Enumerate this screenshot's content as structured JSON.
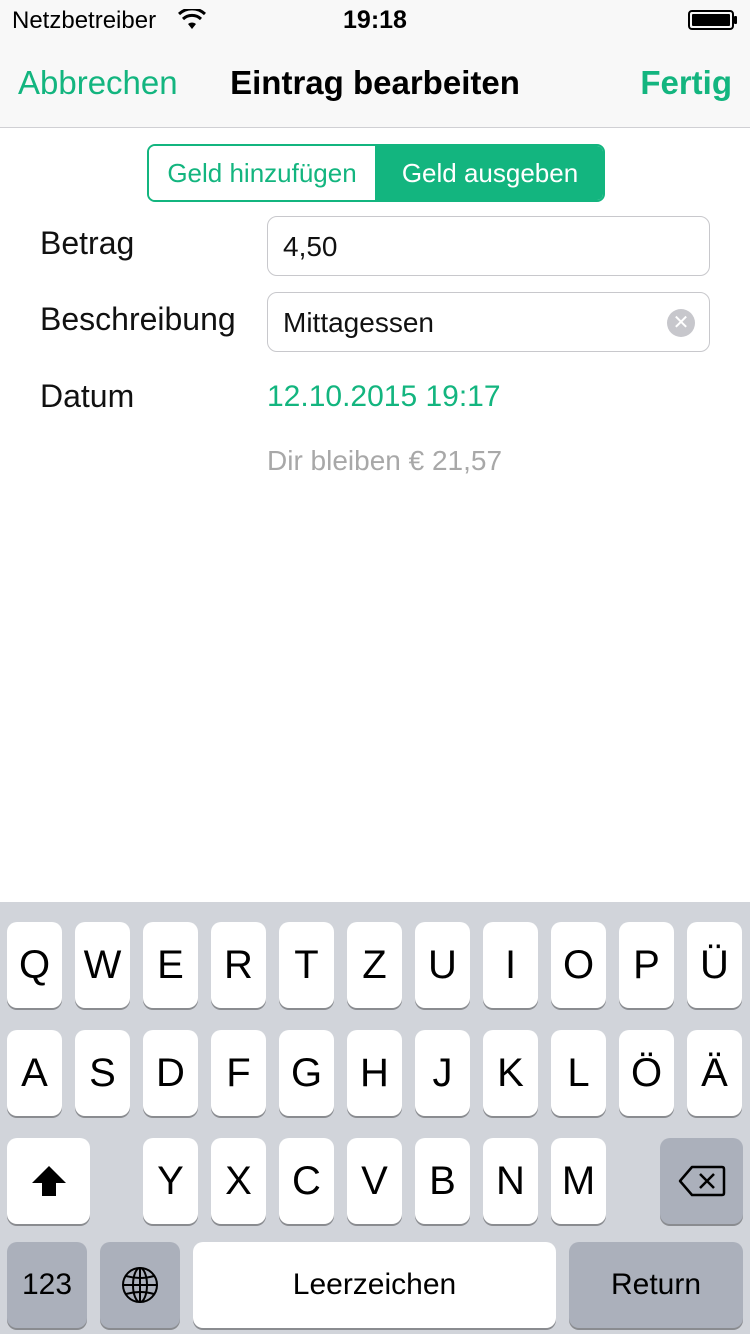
{
  "status_bar": {
    "carrier": "Netzbetreiber",
    "time": "19:18"
  },
  "nav": {
    "cancel": "Abbrechen",
    "title": "Eintrag bearbeiten",
    "done": "Fertig"
  },
  "segment": {
    "add": "Geld hinzufügen",
    "spend": "Geld ausgeben",
    "selected": "spend"
  },
  "form": {
    "amount_label": "Betrag",
    "amount_value": "4,50",
    "description_label": "Beschreibung",
    "description_value": "Mittagessen",
    "date_label": "Datum",
    "date_value": "12.10.2015 19:17",
    "remaining": "Dir bleiben € 21,57"
  },
  "keyboard": {
    "row1": [
      "Q",
      "W",
      "E",
      "R",
      "T",
      "Z",
      "U",
      "I",
      "O",
      "P",
      "Ü"
    ],
    "row2": [
      "A",
      "S",
      "D",
      "F",
      "G",
      "H",
      "J",
      "K",
      "L",
      "Ö",
      "Ä"
    ],
    "row3": [
      "Y",
      "X",
      "C",
      "V",
      "B",
      "N",
      "M"
    ],
    "numbers": "123",
    "space": "Leerzeichen",
    "return": "Return",
    "icons": {
      "shift": "shift-icon",
      "delete": "backspace-icon",
      "globe": "globe-icon"
    }
  },
  "colors": {
    "accent": "#13b57f",
    "keyboard_bg": "#d1d4da",
    "dark_key": "#abb0bb"
  }
}
